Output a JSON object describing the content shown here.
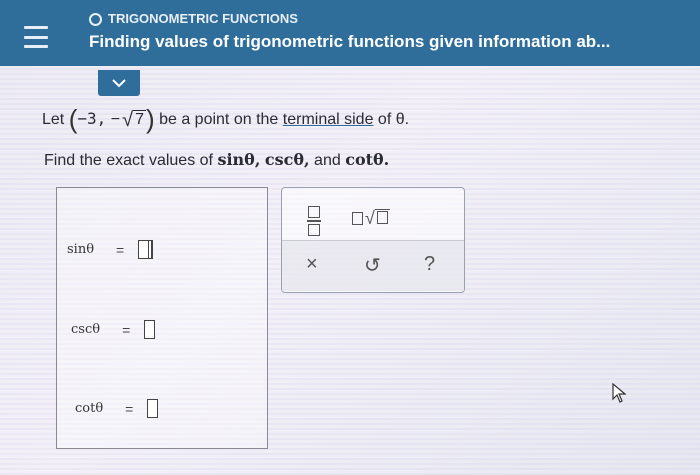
{
  "header": {
    "menu_icon": "hamburger-menu-icon",
    "topic": "TRIGONOMETRIC FUNCTIONS",
    "title": "Finding values of trigonometric functions given information ab..."
  },
  "collapse_icon": "chevron-down-icon",
  "problem": {
    "prefix": "Let",
    "point_x": "−3,",
    "point_y_sign": "−",
    "radicand": "7",
    "middle": "be a point on the",
    "link": "terminal side",
    "suffix": "of θ."
  },
  "instruction": {
    "prefix": "Find the exact values of",
    "f1": "sinθ,",
    "f2": "cscθ,",
    "connector": "and",
    "f3": "cotθ."
  },
  "answers": [
    {
      "label": "sinθ",
      "eq": "="
    },
    {
      "label": "cscθ",
      "eq": "="
    },
    {
      "label": "cotθ",
      "eq": "="
    }
  ],
  "toolbar": {
    "fraction_icon": "fraction-icon",
    "sqrt_icon": "square-root-icon",
    "clear_glyph": "×",
    "undo_glyph": "↺",
    "help_glyph": "?"
  },
  "colors": {
    "header_bg": "#2f6e9b"
  }
}
